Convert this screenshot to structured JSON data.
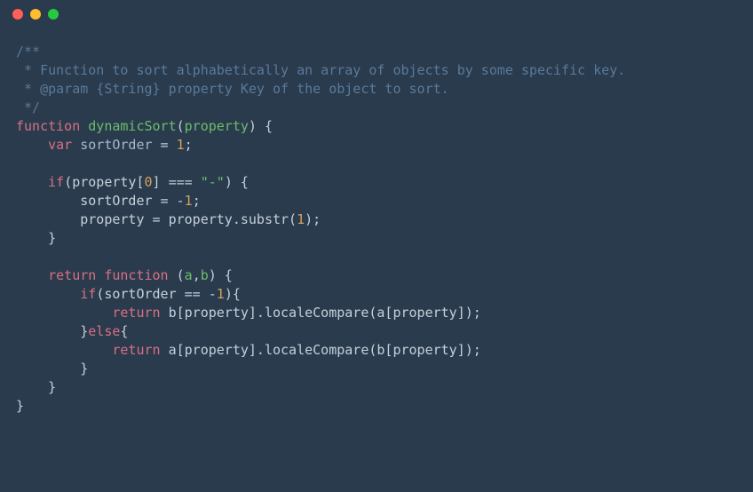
{
  "titlebar": {
    "dot_red": "red",
    "dot_yellow": "yellow",
    "dot_green": "green"
  },
  "code": {
    "c1": "/**",
    "c2": " * Function to sort alphabetically an array of objects by some specific k",
    "c2b": "e",
    "c2c": "y.",
    "c3": " * @param {String} property Key of the object to sort.",
    "c4": " */",
    "kw_function": "function",
    "fn_name": "dynamicSort",
    "paren_open": "(",
    "param_property": "property",
    "paren_close": ")",
    "brace_open": " {",
    "indent1": "    ",
    "kw_var": "var",
    "sp": " ",
    "var_sortOrder": "sortOrder",
    "eq": " = ",
    "num_1": "1",
    "semi": ";",
    "blank": "",
    "kw_if": "if",
    "if_cond_open": "(",
    "prop_access": "property",
    "bracket_open": "[",
    "num_0": "0",
    "bracket_close": "]",
    "triple_eq": " === ",
    "str_dash": "\"-\"",
    "if_cond_close": ")",
    "indent2": "        ",
    "sortOrder_assign": "sortOrder = -",
    "num_1b": "1",
    "prop_assign_pre": "property = property.substr(",
    "num_1c": "1",
    "prop_assign_post": ");",
    "brace_close1": "    }",
    "kw_return": "return",
    "kw_function2": "function",
    "params_ab_open": " (",
    "param_a": "a",
    "comma": ",",
    "param_b": "b",
    "params_ab_close": ") {",
    "if2_open": "if",
    "if2_cond": "(sortOrder == -",
    "num_1d": "1",
    "if2_close": "){",
    "indent3": "            ",
    "ret_b": "b[property].localeCompare(a[property]);",
    "else_open": "}",
    "kw_else": "else",
    "else_brace": "{",
    "ret_a": "a[property].localeCompare(b[property]);",
    "brace_close2": "        }",
    "brace_close3": "    }",
    "brace_close4": "}"
  }
}
